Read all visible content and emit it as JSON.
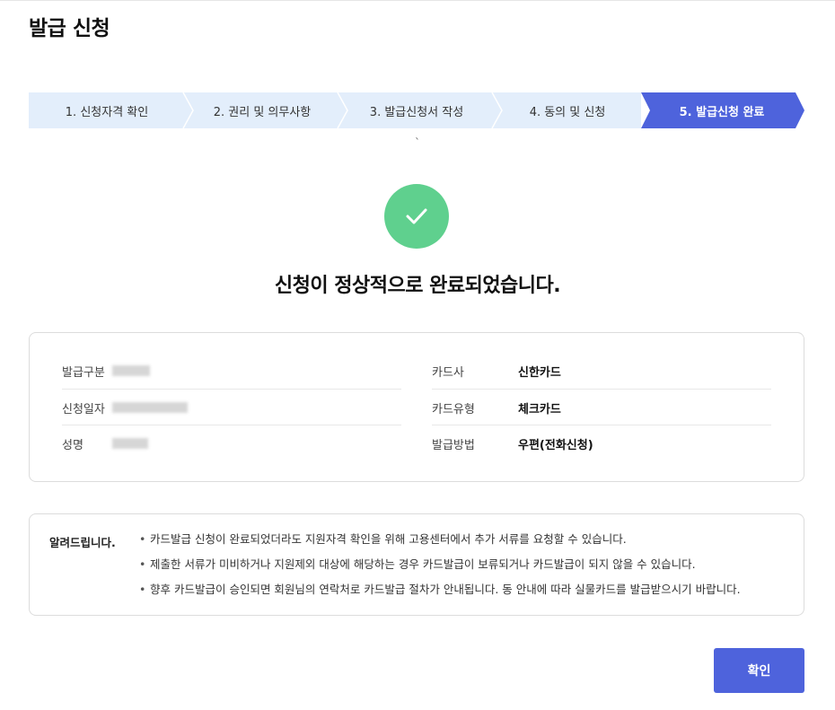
{
  "page": {
    "title": "발급 신청"
  },
  "steps": [
    {
      "label": "1. 신청자격 확인",
      "active": false
    },
    {
      "label": "2. 권리 및 의무사항",
      "active": false
    },
    {
      "label": "3. 발급신청서 작성",
      "active": false
    },
    {
      "label": "4. 동의 및 신청",
      "active": false
    },
    {
      "label": "5. 발급신청 완료",
      "active": true
    }
  ],
  "stray_mark": "`",
  "result": {
    "icon": "check-icon",
    "message": "신청이 정상적으로 완료되었습니다."
  },
  "info": {
    "left": [
      {
        "label": "발급구분",
        "value": ""
      },
      {
        "label": "신청일자",
        "value": ""
      },
      {
        "label": "성명",
        "value": ""
      }
    ],
    "right": [
      {
        "label": "카드사",
        "value": "신한카드"
      },
      {
        "label": "카드유형",
        "value": "체크카드"
      },
      {
        "label": "발급방법",
        "value": "우편(전화신청)"
      }
    ]
  },
  "notice": {
    "title": "알려드립니다.",
    "items": [
      "카드발급 신청이 완료되었더라도 지원자격 확인을 위해 고용센터에서 추가 서류를 요청할 수 있습니다.",
      "제출한 서류가 미비하거나 지원제외 대상에 해당하는 경우 카드발급이 보류되거나 카드발급이 되지 않을 수 있습니다.",
      "향후 카드발급이 승인되면 회원님의 연락처로 카드발급 절차가 안내됩니다. 동 안내에 따라 실물카드를 발급받으시기 바랍니다."
    ]
  },
  "actions": {
    "confirm_label": "확인"
  },
  "colors": {
    "accent": "#4e63dc",
    "step_bg": "#e3eefb",
    "success": "#5fd08e"
  }
}
